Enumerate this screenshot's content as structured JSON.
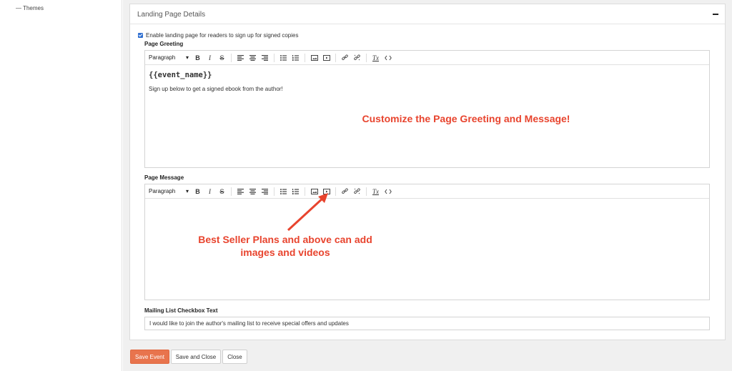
{
  "sidebar": {
    "item": "— Themes"
  },
  "panel": {
    "title": "Landing Page Details",
    "enable_label": "Enable landing page for readers to sign up for signed copies",
    "greeting_label": "Page Greeting",
    "message_label": "Page Message",
    "mailing_label": "Mailing List Checkbox Text",
    "mailing_value": "I would like to join the author's mailing list to receive special offers and updates"
  },
  "toolbar": {
    "format_select": "Paragraph",
    "bold": "B",
    "italic": "I",
    "strike": "S",
    "clear_format": "Tx"
  },
  "greeting": {
    "heading": "{{event_name}}",
    "body": "Sign up below to get a signed ebook from the author!"
  },
  "annotations": {
    "greeting_note": "Customize the Page Greeting and Message!",
    "message_note_line1": "Best Seller Plans and above can add",
    "message_note_line2": "images and videos"
  },
  "buttons": {
    "save_event": "Save Event",
    "save_close": "Save and Close",
    "close": "Close"
  },
  "colors": {
    "accent": "#e8744d",
    "annotation": "#e8442e",
    "checkbox": "#2f6fd1"
  }
}
